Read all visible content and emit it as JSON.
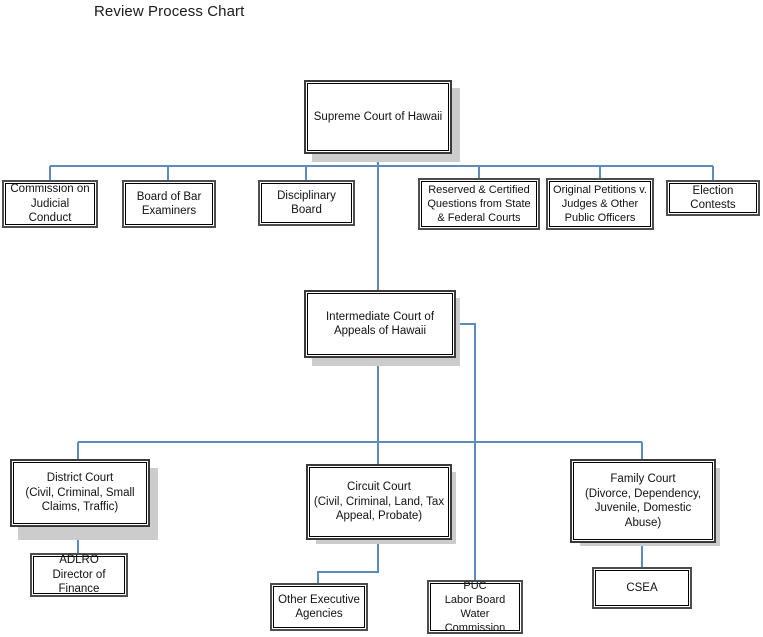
{
  "title": "Review Process Chart",
  "colors": {
    "connector": "#5B8CBE",
    "box_border_outer": "#4d4d4d",
    "box_border_inner": "#000000",
    "shadow": "#cccccc",
    "background": "#ffffff",
    "text": "#111111"
  },
  "nodes": {
    "supreme_court": {
      "label": "Supreme Court of Hawaii"
    },
    "commission_judicial_conduct": {
      "label": "Commission on\nJudicial Conduct"
    },
    "board_bar_examiners": {
      "label": "Board of Bar\nExaminers"
    },
    "disciplinary_board": {
      "label": "Disciplinary Board"
    },
    "reserved_certified_questions": {
      "label": "Reserved & Certified\nQuestions from State\n& Federal Courts"
    },
    "original_petitions": {
      "label": "Original Petitions v.\nJudges & Other\nPublic Officers"
    },
    "election_contests": {
      "label": "Election Contests"
    },
    "intermediate_court": {
      "label": "Intermediate Court of\nAppeals of Hawaii"
    },
    "district_court": {
      "label": "District Court\n(Civil, Criminal, Small\nClaims, Traffic)"
    },
    "circuit_court": {
      "label": "Circuit Court\n(Civil, Criminal, Land, Tax\nAppeal, Probate)"
    },
    "family_court": {
      "label": "Family Court\n(Divorce, Dependency,\nJuvenile, Domestic Abuse)"
    },
    "adlro": {
      "label": "ADLRO\nDirector of Finance"
    },
    "other_executive_agencies": {
      "label": "Other Executive\nAgencies"
    },
    "puc": {
      "label": "PUC\nLabor Board\nWater Commission"
    },
    "csea": {
      "label": "CSEA"
    }
  },
  "chart_data": {
    "type": "diagram",
    "diagram_type": "organizational-chart",
    "title": "Review Process Chart",
    "levels": [
      {
        "level": 1,
        "nodes": [
          "Supreme Court of Hawaii"
        ]
      },
      {
        "level": 2,
        "nodes": [
          "Commission on Judicial Conduct",
          "Board of Bar Examiners",
          "Disciplinary Board",
          "Reserved & Certified Questions from State & Federal Courts",
          "Original Petitions v. Judges & Other Public Officers",
          "Election Contests"
        ]
      },
      {
        "level": 3,
        "nodes": [
          "Intermediate Court of Appeals of Hawaii"
        ]
      },
      {
        "level": 4,
        "nodes": [
          "District Court (Civil, Criminal, Small Claims, Traffic)",
          "Circuit Court (Civil, Criminal, Land, Tax Appeal, Probate)",
          "Family Court (Divorce, Dependency, Juvenile, Domestic Abuse)"
        ]
      },
      {
        "level": 5,
        "nodes": [
          "ADLRO Director of Finance",
          "Other Executive Agencies",
          "PUC Labor Board Water Commission",
          "CSEA"
        ]
      }
    ],
    "edges": [
      {
        "from": "Supreme Court of Hawaii",
        "to": "Commission on Judicial Conduct"
      },
      {
        "from": "Supreme Court of Hawaii",
        "to": "Board of Bar Examiners"
      },
      {
        "from": "Supreme Court of Hawaii",
        "to": "Disciplinary Board"
      },
      {
        "from": "Supreme Court of Hawaii",
        "to": "Reserved & Certified Questions from State & Federal Courts"
      },
      {
        "from": "Supreme Court of Hawaii",
        "to": "Original Petitions v. Judges & Other Public Officers"
      },
      {
        "from": "Supreme Court of Hawaii",
        "to": "Election Contests"
      },
      {
        "from": "Supreme Court of Hawaii",
        "to": "Intermediate Court of Appeals of Hawaii"
      },
      {
        "from": "Intermediate Court of Appeals of Hawaii",
        "to": "District Court (Civil, Criminal, Small Claims, Traffic)"
      },
      {
        "from": "Intermediate Court of Appeals of Hawaii",
        "to": "Circuit Court (Civil, Criminal, Land, Tax Appeal, Probate)"
      },
      {
        "from": "Intermediate Court of Appeals of Hawaii",
        "to": "Family Court (Divorce, Dependency, Juvenile, Domestic Abuse)"
      },
      {
        "from": "Intermediate Court of Appeals of Hawaii",
        "to": "PUC Labor Board Water Commission"
      },
      {
        "from": "District Court (Civil, Criminal, Small Claims, Traffic)",
        "to": "ADLRO Director of Finance"
      },
      {
        "from": "Circuit Court (Civil, Criminal, Land, Tax Appeal, Probate)",
        "to": "Other Executive Agencies"
      },
      {
        "from": "Family Court (Divorce, Dependency, Juvenile, Domestic Abuse)",
        "to": "CSEA"
      }
    ]
  }
}
